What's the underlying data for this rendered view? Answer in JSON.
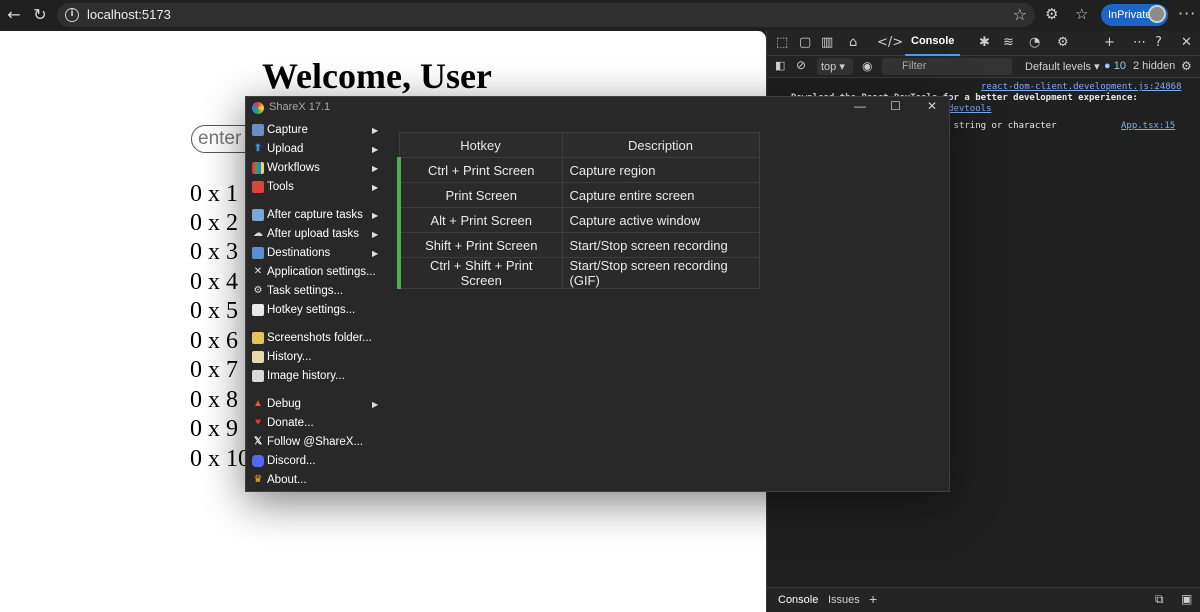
{
  "browser": {
    "url": "localhost:5173",
    "inprivate_label": "InPrivate"
  },
  "page": {
    "heading": "Welcome, User",
    "input_placeholder": "enter",
    "rows": [
      "0 x 1",
      "0 x 2",
      "0 x 3",
      "0 x 4",
      "0 x 5",
      "0 x 6",
      "0 x 7",
      "0 x 8",
      "0 x 9",
      "0 x 10"
    ]
  },
  "devtools": {
    "tab_console": "Console",
    "context": "top",
    "filter_placeholder": "Filter",
    "levels": "Default levels",
    "issues_count": "10",
    "hidden": "2 hidden",
    "log_link1": "react-dom-client.development.js:24868",
    "log_text1": "Download the React DevTools for a better development experience:",
    "log_link1b": "https://react.dev/link/react-devtools",
    "log_text2": "Warning: Received NaN for the string or character",
    "log_link2": "App.tsx:15",
    "bottom_console": "Console",
    "bottom_issues": "Issues"
  },
  "sharex": {
    "title": "ShareX 17.1",
    "menu": [
      {
        "label": "Capture",
        "arrow": true
      },
      {
        "label": "Upload",
        "arrow": true
      },
      {
        "label": "Workflows",
        "arrow": true
      },
      {
        "label": "Tools",
        "arrow": true
      },
      {
        "label": "After capture tasks",
        "arrow": true
      },
      {
        "label": "After upload tasks",
        "arrow": true
      },
      {
        "label": "Destinations",
        "arrow": true
      },
      {
        "label": "Application settings...",
        "arrow": false
      },
      {
        "label": "Task settings...",
        "arrow": false
      },
      {
        "label": "Hotkey settings...",
        "arrow": false
      },
      {
        "label": "Screenshots folder...",
        "arrow": false
      },
      {
        "label": "History...",
        "arrow": false
      },
      {
        "label": "Image history...",
        "arrow": false
      },
      {
        "label": "Debug",
        "arrow": true
      },
      {
        "label": "Donate...",
        "arrow": false
      },
      {
        "label": "Follow @ShareX...",
        "arrow": false
      },
      {
        "label": "Discord...",
        "arrow": false
      },
      {
        "label": "About...",
        "arrow": false
      }
    ],
    "table": {
      "headers": [
        "Hotkey",
        "Description"
      ],
      "rows": [
        [
          "Ctrl + Print Screen",
          "Capture region"
        ],
        [
          "Print Screen",
          "Capture entire screen"
        ],
        [
          "Alt + Print Screen",
          "Capture active window"
        ],
        [
          "Shift + Print Screen",
          "Start/Stop screen recording"
        ],
        [
          "Ctrl + Shift + Print Screen",
          "Start/Stop screen recording (GIF)"
        ]
      ]
    },
    "accent_color": "#4caf50"
  }
}
